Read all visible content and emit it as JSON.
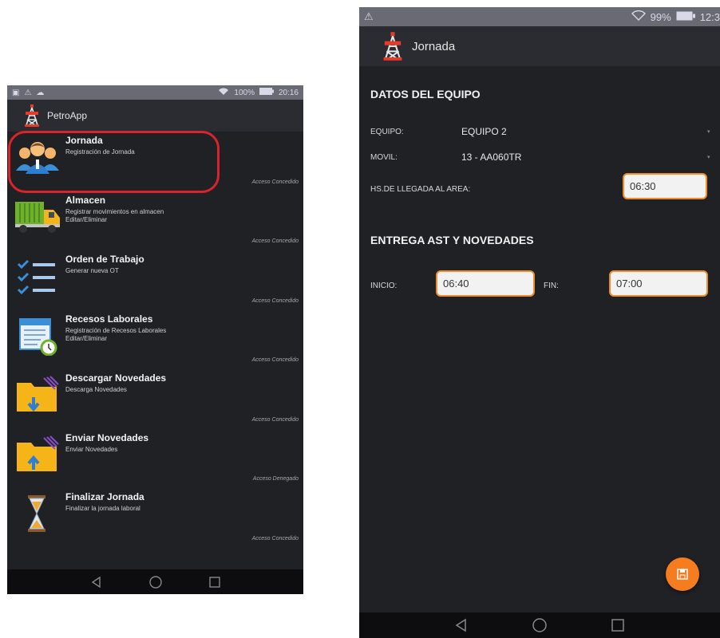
{
  "left_screen": {
    "status_bar": {
      "battery": "100%",
      "time": "20:16"
    },
    "app_title": "PetroApp",
    "menu": [
      {
        "title": "Jornada",
        "subtitle": "Registración de Jornada",
        "subtitle2": "",
        "access": "Acceso Concedido",
        "icon": "team-icon"
      },
      {
        "title": "Almacen",
        "subtitle": "Registrar movimientos en almacen",
        "subtitle2": "Editar/Eliminar",
        "access": "Acceso Concedido",
        "icon": "truck-icon"
      },
      {
        "title": "Orden de Trabajo",
        "subtitle": "Generar nueva OT",
        "subtitle2": "",
        "access": "Acceso Concedido",
        "icon": "checklist-icon"
      },
      {
        "title": "Recesos Laborales",
        "subtitle": "Registración de Recesos Laborales",
        "subtitle2": "Editar/Eliminar",
        "access": "Acceso Concedido",
        "icon": "calendar-clock-icon"
      },
      {
        "title": "Descargar Novedades",
        "subtitle": "Descarga Novedades",
        "subtitle2": "",
        "access": "Acceso Concedido",
        "icon": "folder-download-icon"
      },
      {
        "title": "Enviar Novedades",
        "subtitle": "Enviar Novedades",
        "subtitle2": "",
        "access": "Acceso Denegado",
        "icon": "folder-upload-icon"
      },
      {
        "title": "Finalizar Jornada",
        "subtitle": "Finalizar la jornada laboral",
        "subtitle2": "",
        "access": "Acceso Concedido",
        "icon": "hourglass-icon"
      }
    ]
  },
  "right_screen": {
    "status_bar": {
      "battery": "99%",
      "time": "12:3"
    },
    "app_title": "Jornada",
    "section_equipo": "DATOS DEL EQUIPO",
    "equipo_label": "EQUIPO:",
    "equipo_value": "EQUIPO 2",
    "movil_label": "MOVIL:",
    "movil_value": "13 - AA060TR",
    "llegada_label": "HS.DE LLEGADA AL AREA:",
    "llegada_value": "06:30",
    "section_entrega": "ENTREGA AST Y NOVEDADES",
    "inicio_label": "INICIO:",
    "inicio_value": "06:40",
    "fin_label": "FIN:",
    "fin_value": "07:00"
  },
  "colors": {
    "accent": "#f18c2a",
    "highlight": "#d8242a",
    "background": "#1f2125",
    "status_bar": "#6a6a74"
  }
}
